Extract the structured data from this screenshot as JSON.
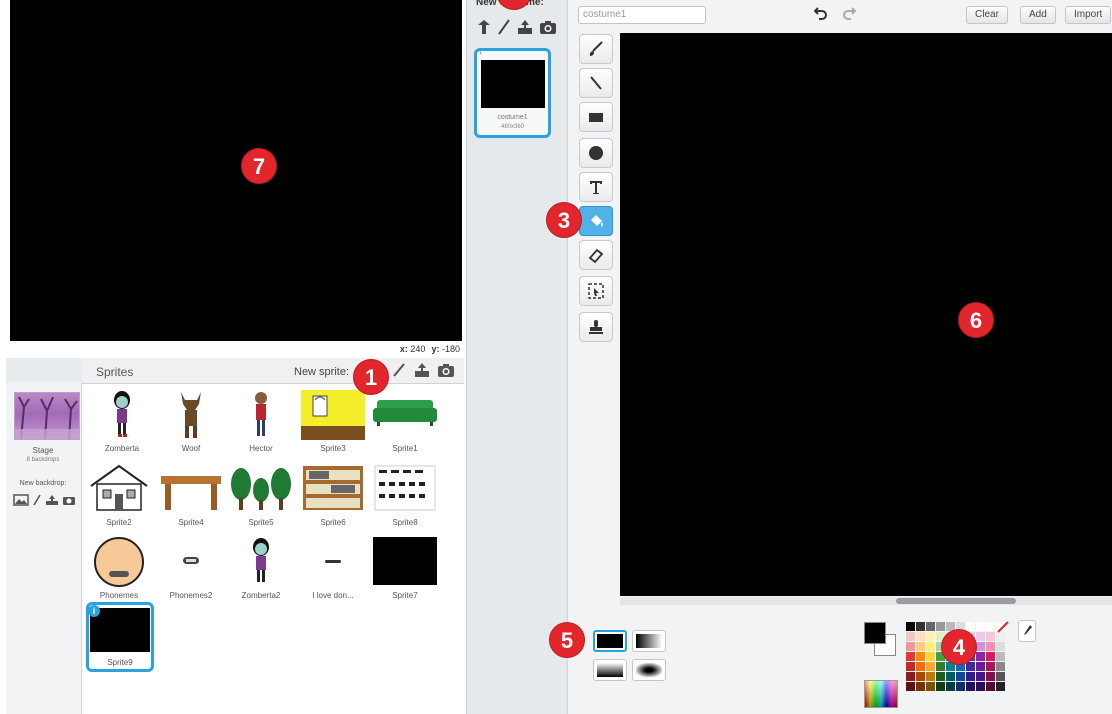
{
  "stage": {
    "x_label": "x:",
    "x_value": "240",
    "y_label": "y:",
    "y_value": "-180"
  },
  "sprites_panel": {
    "title": "Sprites",
    "new_sprite_label": "New sprite:",
    "stage_label": "Stage",
    "stage_sub": "8 backdrops",
    "new_backdrop_label": "New backdrop:",
    "sprites": [
      {
        "name": "Zomberta"
      },
      {
        "name": "Woof"
      },
      {
        "name": "Hector"
      },
      {
        "name": "Sprite3"
      },
      {
        "name": "Sprite1"
      },
      {
        "name": "Sprite2"
      },
      {
        "name": "Sprite4"
      },
      {
        "name": "Sprite5"
      },
      {
        "name": "Sprite6"
      },
      {
        "name": "Sprite8"
      },
      {
        "name": "Phonemes"
      },
      {
        "name": "Phonemes2"
      },
      {
        "name": "Zomberta2"
      },
      {
        "name": "I love don..."
      },
      {
        "name": "Sprite7"
      },
      {
        "name": "Sprite9"
      }
    ]
  },
  "costumes": {
    "new_costume_label": "New costume:",
    "tile_number": "1",
    "tile_name": "costume1",
    "tile_size": "480x360"
  },
  "editor": {
    "costume_name_value": "costume1",
    "clear_label": "Clear",
    "add_label": "Add",
    "import_label": "Import",
    "tools": [
      "brush-icon",
      "line-icon",
      "rectangle-icon",
      "ellipse-icon",
      "text-icon",
      "fill-bucket-icon",
      "eraser-icon",
      "select-icon",
      "stamp-icon"
    ],
    "active_tool": "fill-bucket-icon",
    "primary_color": "#000000",
    "secondary_color": "#ffffff"
  },
  "callouts": {
    "one": "1",
    "three": "3",
    "four": "4",
    "five": "5",
    "six": "6",
    "seven": "7"
  },
  "colors": {
    "accent": "#2aa2e0",
    "callout": "#e2262c",
    "stage_bg": "#000000"
  }
}
